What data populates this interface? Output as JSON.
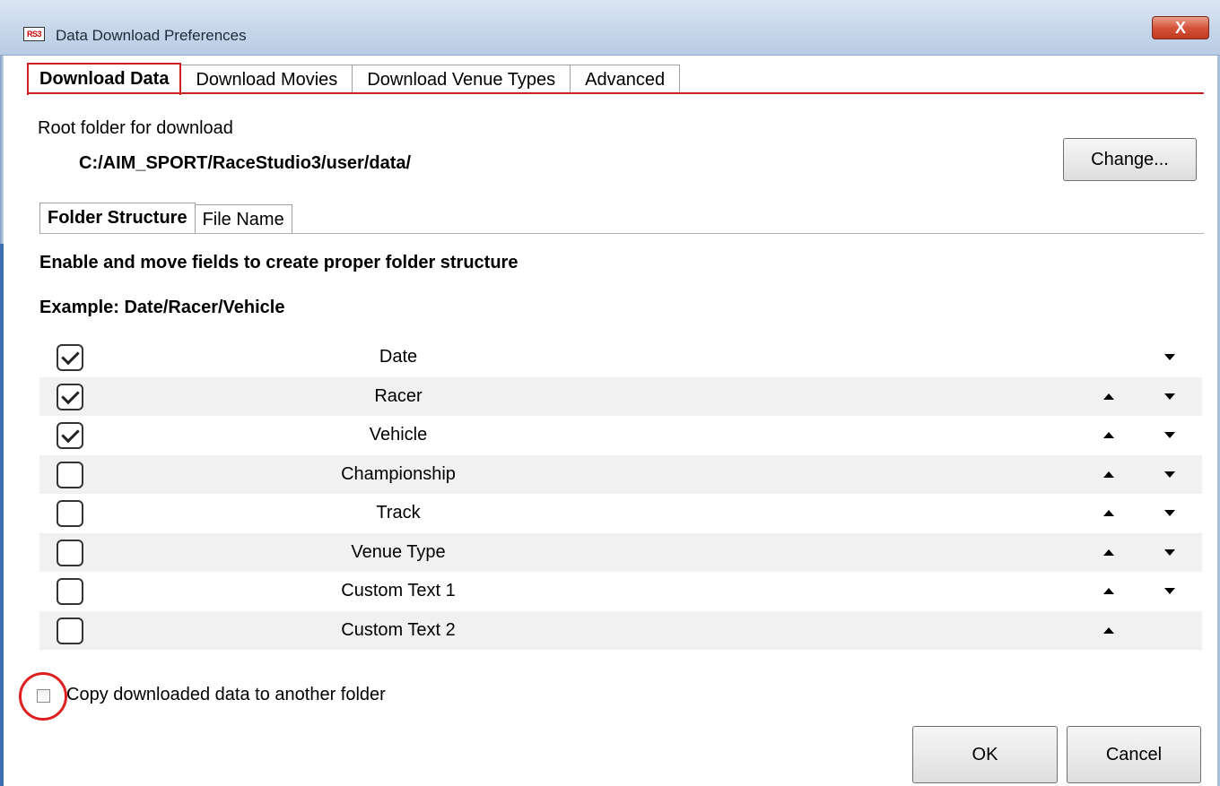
{
  "window": {
    "app_icon": "RS3",
    "title": "Data Download Preferences",
    "close_glyph": "X"
  },
  "tabs": [
    {
      "label": "Download Data",
      "active": true
    },
    {
      "label": "Download Movies",
      "active": false
    },
    {
      "label": "Download Venue Types",
      "active": false
    },
    {
      "label": "Advanced",
      "active": false
    }
  ],
  "download": {
    "root_label": "Root folder for download",
    "root_path": "C:/AIM_SPORT/RaceStudio3/user/data/",
    "change_label": "Change..."
  },
  "subtabs": [
    {
      "label": "Folder Structure",
      "active": true
    },
    {
      "label": "File Name",
      "active": false
    }
  ],
  "instructions": "Enable and move fields to create proper folder structure",
  "example": "Example: Date/Racer/Vehicle",
  "fields": [
    {
      "label": "Date",
      "checked": true,
      "up": false,
      "down": true
    },
    {
      "label": "Racer",
      "checked": true,
      "up": true,
      "down": true
    },
    {
      "label": "Vehicle",
      "checked": true,
      "up": true,
      "down": true
    },
    {
      "label": "Championship",
      "checked": false,
      "up": true,
      "down": true
    },
    {
      "label": "Track",
      "checked": false,
      "up": true,
      "down": true
    },
    {
      "label": "Venue Type",
      "checked": false,
      "up": true,
      "down": true
    },
    {
      "label": "Custom Text 1",
      "checked": false,
      "up": true,
      "down": true
    },
    {
      "label": "Custom Text 2",
      "checked": false,
      "up": true,
      "down": false
    }
  ],
  "copy": {
    "label": "Copy downloaded data to another folder",
    "checked": false
  },
  "footer": {
    "ok_label": "OK",
    "cancel_label": "Cancel"
  },
  "colors": {
    "active_tab_border": "#cc2222",
    "highlight_circle": "#e02020",
    "alt_row": "#f1f1f1"
  }
}
